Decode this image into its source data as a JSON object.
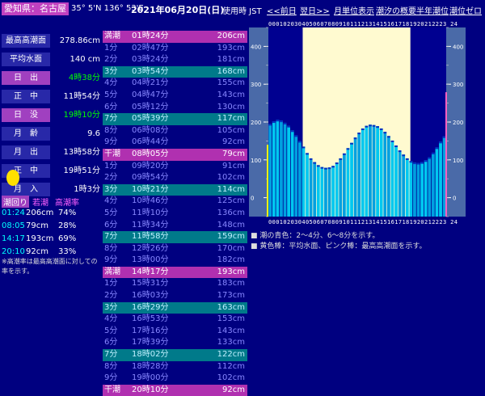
{
  "header": {
    "location": "愛知県：名古屋",
    "coordinates": "35° 5'N 136° 53'E",
    "date": "2021年06月20日(日)",
    "timezone": "使用時 JST",
    "nav": [
      "<<前日",
      "翌日>>",
      "月単位表示",
      "潮汐の概要",
      "半年潮位",
      "潮位ゼロ"
    ]
  },
  "info": [
    {
      "label": "最高高潮面",
      "value": "278.86cm",
      "highlight": false,
      "green": false
    },
    {
      "label": "平均水面",
      "value": "140 cm",
      "highlight": false,
      "green": false
    },
    {
      "label": "日　出",
      "value": "4時38分",
      "highlight": true,
      "green": true
    },
    {
      "label": "正　中",
      "value": "11時54分",
      "highlight": false,
      "green": false
    },
    {
      "label": "日　没",
      "value": "19時10分",
      "highlight": true,
      "green": true
    },
    {
      "label": "月　齢",
      "value": "9.6",
      "highlight": false,
      "green": false
    },
    {
      "label": "月　出",
      "value": "13時58分",
      "highlight": false,
      "green": false
    },
    {
      "label": "正　中",
      "value": "19時51分",
      "highlight": false,
      "green": false
    },
    {
      "label": "月　入",
      "value": "1時3分",
      "highlight": false,
      "green": false
    }
  ],
  "hl_headers": [
    "潮回り",
    "若潮",
    "高潮率"
  ],
  "hl_rows": [
    {
      "time": "01:24",
      "height": "206cm",
      "rate": "74%"
    },
    {
      "time": "08:05",
      "height": "79cm",
      "rate": "28%"
    },
    {
      "time": "14:17",
      "height": "193cm",
      "rate": "69%"
    },
    {
      "time": "20:10",
      "height": "92cm",
      "rate": "33%"
    }
  ],
  "hl_note": "※高潮率は最高高潮面に対しての率を示す。",
  "table": [
    {
      "k": "満潮",
      "t": "01時24分",
      "h": "206cm",
      "type": "high"
    },
    {
      "k": "1分",
      "t": "02時47分",
      "h": "193cm",
      "type": "c0"
    },
    {
      "k": "2分",
      "t": "03時24分",
      "h": "181cm",
      "type": "c0"
    },
    {
      "k": "3分",
      "t": "03時54分",
      "h": "168cm",
      "type": "c1"
    },
    {
      "k": "4分",
      "t": "04時21分",
      "h": "155cm",
      "type": "c0"
    },
    {
      "k": "5分",
      "t": "04時47分",
      "h": "143cm",
      "type": "c0"
    },
    {
      "k": "6分",
      "t": "05時12分",
      "h": "130cm",
      "type": "c0"
    },
    {
      "k": "7分",
      "t": "05時39分",
      "h": "117cm",
      "type": "c1"
    },
    {
      "k": "8分",
      "t": "06時08分",
      "h": "105cm",
      "type": "c0"
    },
    {
      "k": "9分",
      "t": "06時44分",
      "h": "92cm",
      "type": "c0"
    },
    {
      "k": "干潮",
      "t": "08時05分",
      "h": "79cm",
      "type": "low"
    },
    {
      "k": "1分",
      "t": "09時20分",
      "h": "91cm",
      "type": "c0"
    },
    {
      "k": "2分",
      "t": "09時54分",
      "h": "102cm",
      "type": "c0"
    },
    {
      "k": "3分",
      "t": "10時21分",
      "h": "114cm",
      "type": "c1"
    },
    {
      "k": "4分",
      "t": "10時46分",
      "h": "125cm",
      "type": "c0"
    },
    {
      "k": "5分",
      "t": "11時10分",
      "h": "136cm",
      "type": "c0"
    },
    {
      "k": "6分",
      "t": "11時34分",
      "h": "148cm",
      "type": "c0"
    },
    {
      "k": "7分",
      "t": "11時58分",
      "h": "159cm",
      "type": "c1"
    },
    {
      "k": "8分",
      "t": "12時26分",
      "h": "170cm",
      "type": "c0"
    },
    {
      "k": "9分",
      "t": "13時00分",
      "h": "182cm",
      "type": "c0"
    },
    {
      "k": "満潮",
      "t": "14時17分",
      "h": "193cm",
      "type": "high"
    },
    {
      "k": "1分",
      "t": "15時31分",
      "h": "183cm",
      "type": "c0"
    },
    {
      "k": "2分",
      "t": "16時03分",
      "h": "173cm",
      "type": "c0"
    },
    {
      "k": "3分",
      "t": "16時29分",
      "h": "163cm",
      "type": "c1"
    },
    {
      "k": "4分",
      "t": "16時53分",
      "h": "153cm",
      "type": "c0"
    },
    {
      "k": "5分",
      "t": "17時16分",
      "h": "143cm",
      "type": "c0"
    },
    {
      "k": "6分",
      "t": "17時39分",
      "h": "133cm",
      "type": "c0"
    },
    {
      "k": "7分",
      "t": "18時02分",
      "h": "122cm",
      "type": "c1"
    },
    {
      "k": "8分",
      "t": "18時28分",
      "h": "112cm",
      "type": "c0"
    },
    {
      "k": "9分",
      "t": "19時00分",
      "h": "102cm",
      "type": "c0"
    },
    {
      "k": "干潮",
      "t": "20時10分",
      "h": "92cm",
      "type": "low"
    }
  ],
  "chart": {
    "hour_labels": "000102030405060708091011121314151617181920212223 24",
    "yticks": [
      400,
      300,
      200,
      100,
      0
    ],
    "sunrise_hour": 4.633,
    "sunset_hour": 19.167,
    "mean_level": 140,
    "max_level": 278.86,
    "colors": {
      "bar": "#00c8f0",
      "bar_alt": "#00a0e0",
      "day": "#fffad0",
      "mean": "#ffff00",
      "max": "#ff60c0"
    }
  },
  "chart_data": {
    "type": "bar",
    "title": "",
    "xlabel": "",
    "ylabel": "",
    "ylim": [
      -50,
      450
    ],
    "x": [
      0,
      0.5,
      1,
      1.5,
      2,
      2.5,
      3,
      3.5,
      4,
      4.5,
      5,
      5.5,
      6,
      6.5,
      7,
      7.5,
      8,
      8.5,
      9,
      9.5,
      10,
      10.5,
      11,
      11.5,
      12,
      12.5,
      13,
      13.5,
      14,
      14.5,
      15,
      15.5,
      16,
      16.5,
      17,
      17.5,
      18,
      18.5,
      19,
      19.5,
      20,
      20.5,
      21,
      21.5,
      22,
      22.5,
      23,
      23.5
    ],
    "values": [
      195,
      202,
      206,
      204,
      198,
      190,
      178,
      165,
      150,
      135,
      118,
      104,
      94,
      86,
      81,
      79,
      80,
      84,
      93,
      104,
      117,
      131,
      145,
      159,
      172,
      183,
      190,
      193,
      192,
      189,
      183,
      174,
      163,
      151,
      138,
      125,
      114,
      104,
      97,
      93,
      92,
      94,
      99,
      107,
      119,
      133,
      148,
      162
    ]
  },
  "legend": [
    "■ 潮の青色：2～4分、6～8分を示す。",
    "■ 黄色棒：平均水面、ピンク棒：最高高潮面を示す。"
  ]
}
